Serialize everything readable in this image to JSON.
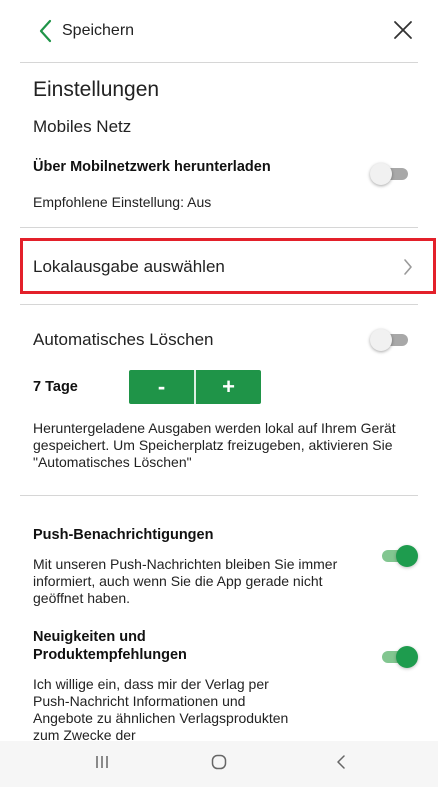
{
  "header": {
    "back_label": "Speichern"
  },
  "settings": {
    "title": "Einstellungen",
    "mobile_section": "Mobiles Netz",
    "mobile_download_label": "Über Mobilnetzwerk herunterladen",
    "mobile_download_hint": "Empfohlene Einstellung: Aus",
    "mobile_download_on": false,
    "local_edition_label": "Lokalausgabe auswählen",
    "auto_delete_label": "Automatisches Löschen",
    "auto_delete_on": false,
    "days_label": "7 Tage",
    "stepper_minus": "-",
    "stepper_plus": "+",
    "auto_delete_info": "Heruntergeladene Ausgaben werden lokal auf Ihrem Gerät gespeichert. Um Speicherplatz freizugeben, aktivieren Sie \"Automatisches Löschen\"",
    "push_label": "Push-Benachrichtigungen",
    "push_desc": "Mit unseren Push-Nachrichten bleiben Sie immer informiert, auch wenn Sie die App gerade nicht geöffnet haben.",
    "push_on": true,
    "news_label": "Neuigkeiten und Produktempfehlungen",
    "news_desc": "Ich willige ein, dass mir der Verlag per Push-Nachricht Informationen und Angebote zu ähnlichen Verlagsprodukten zum Zwecke der",
    "news_on": true
  },
  "colors": {
    "accent_green": "#1f9448",
    "highlight_red": "#e3202a"
  },
  "bottom_nav": {
    "icons": [
      "recent-apps-icon",
      "home-icon",
      "back-icon"
    ]
  }
}
